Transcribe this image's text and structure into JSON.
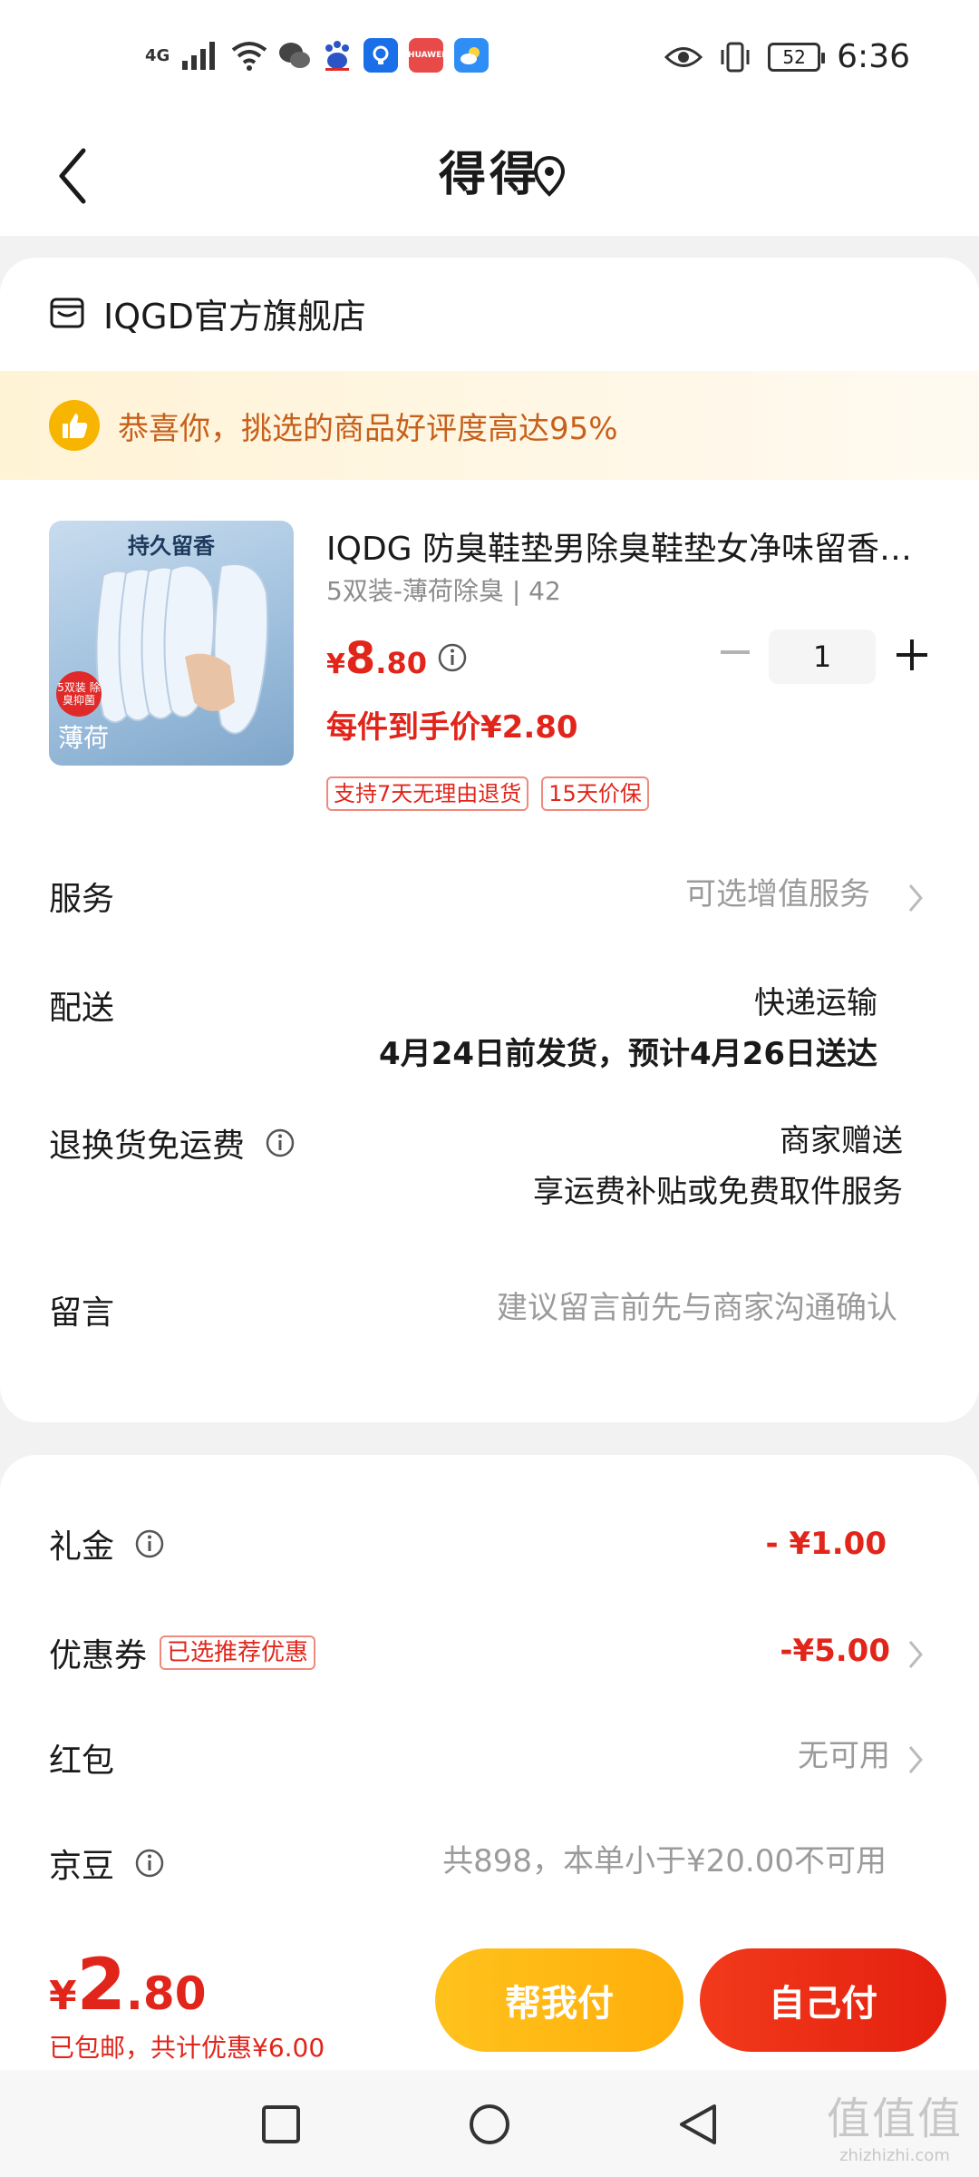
{
  "status_bar": {
    "network": "4G",
    "battery": "52",
    "time": "6:36",
    "icons": [
      "signal-icon",
      "wifi-icon",
      "wechat-icon",
      "baidu-icon",
      "bulb-app-icon",
      "huawei-app-icon",
      "weather-app-icon",
      "eye-icon",
      "vibrate-icon"
    ],
    "huawei_label": "HUAWEI"
  },
  "nav": {
    "title": "得得"
  },
  "shop": {
    "name": "IQGD官方旗舰店"
  },
  "praise": {
    "text": "恭喜你，挑选的商品好评度高达95%"
  },
  "product": {
    "image_banner": "持久留香",
    "image_badge": "5双装 除臭抑菌",
    "image_label": "薄荷",
    "title": "IQDG 防臭鞋垫男除臭鞋垫女净味留香鞋垫",
    "spec": "5双装-薄荷除臭 | 42",
    "price_symbol": "¥",
    "price_int": "8",
    "price_dec": ".80",
    "quantity": "1",
    "per_price": "每件到手价¥2.80",
    "tags": [
      "支持7天无理由退货",
      "15天价保"
    ]
  },
  "rows": {
    "service_label": "服务",
    "service_value": "可选增值服务",
    "delivery_label": "配送",
    "delivery_method": "快递运输",
    "delivery_date": "4月24日前发货，预计4月26日送达",
    "return_label": "退换货免运费",
    "return_value1": "商家赠送",
    "return_value2": "享运费补贴或免费取件服务",
    "message_label": "留言",
    "message_placeholder": "建议留言前先与商家沟通确认"
  },
  "discounts": {
    "gift_label": "礼金",
    "gift_value": "- ¥1.00",
    "coupon_label": "优惠券",
    "coupon_tag": "已选推荐优惠",
    "coupon_value": "-¥5.00",
    "redpacket_label": "红包",
    "redpacket_value": "无可用",
    "jd_bean_label": "京豆",
    "jd_bean_value": "共898，本单小于¥20.00不可用"
  },
  "footer": {
    "total_symbol": "¥",
    "total_int": "2",
    "total_dec": ".80",
    "total_note": "已包邮，共计优惠¥6.00",
    "help_pay_label": "帮我付",
    "self_pay_label": "自己付"
  },
  "watermark": {
    "main": "值值值",
    "sub": "zhizhizhi.com"
  },
  "colors": {
    "accent_red": "#e1251b",
    "accent_yellow": "#ffb612",
    "praise_text": "#c7601b"
  }
}
